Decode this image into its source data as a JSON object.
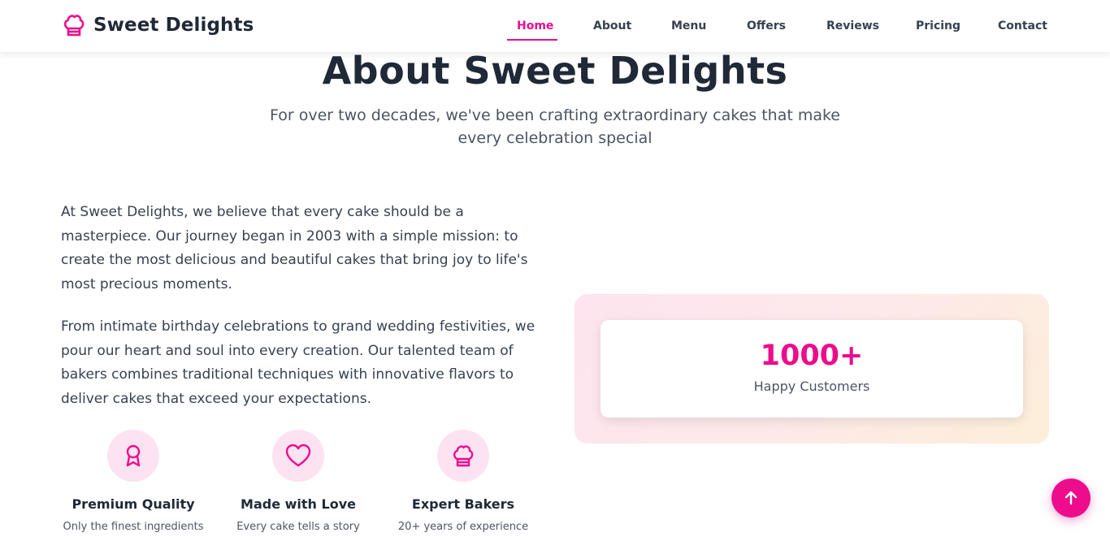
{
  "brand": {
    "name": "Sweet Delights",
    "icon": "chef-hat-icon",
    "accent_color": "#ec0c8c"
  },
  "nav": {
    "items": [
      {
        "label": "Home",
        "active": true
      },
      {
        "label": "About"
      },
      {
        "label": "Menu"
      },
      {
        "label": "Offers"
      },
      {
        "label": "Reviews"
      },
      {
        "label": "Pricing"
      },
      {
        "label": "Contact"
      }
    ]
  },
  "about": {
    "title": "About Sweet Delights",
    "subtitle": "For over two decades, we've been crafting extraordinary cakes that make every celebration special",
    "paragraphs": [
      "At Sweet Delights, we believe that every cake should be a masterpiece. Our journey began in 2003 with a simple mission: to create the most delicious and beautiful cakes that bring joy to life's most precious moments.",
      "From intimate birthday celebrations to grand wedding festivities, we pour our heart and soul into every creation. Our talented team of bakers combines traditional techniques with innovative flavors to deliver cakes that exceed your expectations."
    ],
    "features": [
      {
        "icon": "award-ribbon-icon",
        "title": "Premium Quality",
        "desc": "Only the finest ingredients"
      },
      {
        "icon": "heart-icon",
        "title": "Made with Love",
        "desc": "Every cake tells a story"
      },
      {
        "icon": "chef-hat-icon",
        "title": "Expert Bakers",
        "desc": "20+ years of experience"
      }
    ],
    "stat": {
      "number": "1000+",
      "label": "Happy Customers"
    }
  },
  "scroll_top": {
    "icon": "arrow-up-icon"
  }
}
